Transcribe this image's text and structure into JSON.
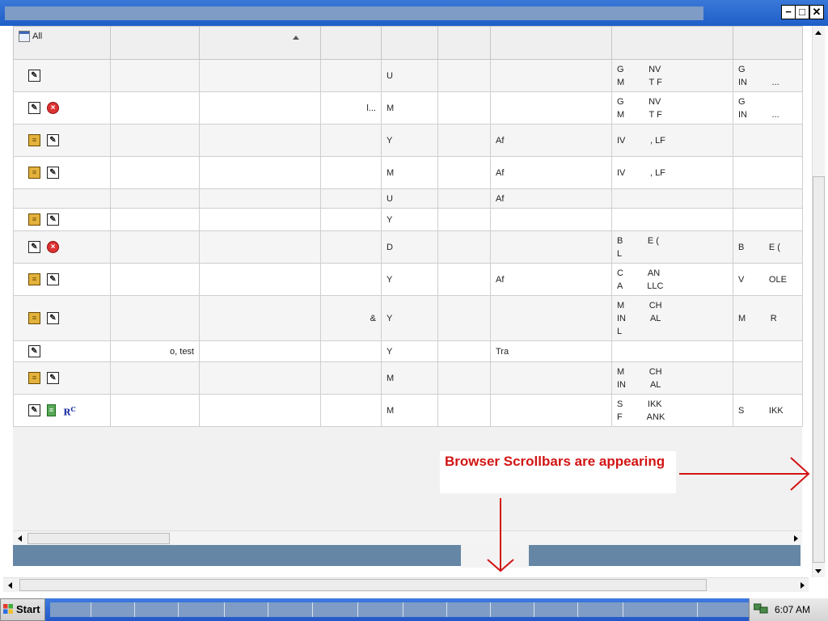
{
  "window": {
    "minimize_label": "−",
    "maximize_label": "□",
    "close_label": "✕"
  },
  "table": {
    "header_first": "All",
    "rows": [
      {
        "icons": [
          "note-icon"
        ],
        "c2": "",
        "c3": "",
        "c4": "",
        "c5": "U",
        "c6": "",
        "c7": "",
        "c8": [
          "G          NV",
          "M          T F"
        ],
        "c9": [
          "G",
          "IN          ..."
        ]
      },
      {
        "icons": [
          "note-icon",
          "error-icon"
        ],
        "c2": "",
        "c3": "",
        "c4": "l...",
        "c5": "M",
        "c6": "",
        "c7": "",
        "c8": [
          "G          NV",
          "M          T F"
        ],
        "c9": [
          "G",
          "IN          ..."
        ]
      },
      {
        "icons": [
          "book-icon",
          "note-icon"
        ],
        "c2": "",
        "c3": "",
        "c4": "",
        "c5": "Y",
        "c6": "",
        "c7": "Af",
        "c8": [
          "IV          , LF"
        ],
        "c9": []
      },
      {
        "icons": [
          "book-icon",
          "note-icon"
        ],
        "c2": "",
        "c3": "",
        "c4": "",
        "c5": "M",
        "c6": "",
        "c7": "Af",
        "c8": [
          "IV          , LF"
        ],
        "c9": []
      },
      {
        "icons": [],
        "c2": "",
        "c3": "",
        "c4": "",
        "c5": "U",
        "c6": "",
        "c7": "Af",
        "c8": [],
        "c9": []
      },
      {
        "icons": [
          "book-icon",
          "note-icon"
        ],
        "c2": "",
        "c3": "",
        "c4": "",
        "c5": "Y",
        "c6": "",
        "c7": "",
        "c8": [],
        "c9": []
      },
      {
        "icons": [
          "note-icon",
          "error-icon"
        ],
        "c2": "",
        "c3": "",
        "c4": "",
        "c5": "D",
        "c6": "",
        "c7": "",
        "c8": [
          "B          E (",
          "L"
        ],
        "c9": [
          "B          E ("
        ]
      },
      {
        "icons": [
          "book-icon",
          "note-icon"
        ],
        "c2": "",
        "c3": "",
        "c4": "",
        "c5": "Y",
        "c6": "",
        "c7": "Af",
        "c8": [
          "C          AN",
          "A          LLC"
        ],
        "c9": [
          "V          OLE"
        ]
      },
      {
        "icons": [
          "book-icon",
          "note-icon"
        ],
        "c2": "",
        "c3": "",
        "c4": "&",
        "c5": "Y",
        "c6": "",
        "c7": "",
        "c8": [
          "M          CH",
          "IN          AL",
          "L"
        ],
        "c9": [
          "M          R"
        ]
      },
      {
        "icons": [
          "note-icon"
        ],
        "c2": "o, test",
        "c3": "",
        "c4": "",
        "c5": "Y",
        "c6": "",
        "c7": "Tra",
        "c8": [],
        "c9": []
      },
      {
        "icons": [
          "book-icon",
          "note-icon"
        ],
        "c2": "",
        "c3": "",
        "c4": "",
        "c5": "M",
        "c6": "",
        "c7": "",
        "c8": [
          "M          CH",
          "IN          AL"
        ],
        "c9": []
      },
      {
        "icons": [
          "note-icon",
          "database-icon",
          "rc-icon"
        ],
        "c2": "",
        "c3": "",
        "c4": "",
        "c5": "M",
        "c6": "",
        "c7": "",
        "c8": [
          "S          IKK",
          "F          ANK"
        ],
        "c9": [
          "S          IKK"
        ]
      }
    ]
  },
  "annotation": {
    "text": "Browser Scrollbars are appearing",
    "color": "#d21414"
  },
  "taskbar": {
    "start_label": "Start",
    "clock": "6:07 AM"
  }
}
